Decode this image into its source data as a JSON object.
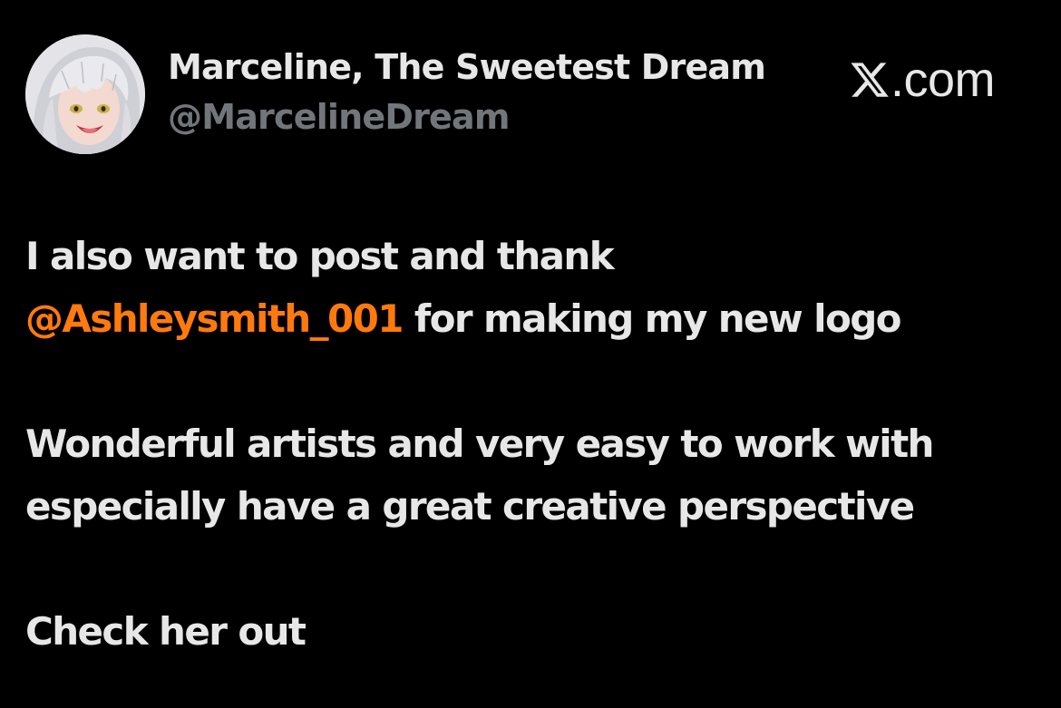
{
  "author": {
    "display_name": "Marceline, The Sweetest Dream",
    "handle": "@MarcelineDream",
    "avatar_icon": "anime-character-avatar"
  },
  "brand": {
    "icon": "x-logo-icon",
    "text": ".com"
  },
  "post": {
    "line1": "I also want to post and thank",
    "mention": "@Ashleysmith_001",
    "line2_rest": " for making my new logo",
    "line3": "Wonderful artists and very easy to work with",
    "line4": "especially have a great creative perspective",
    "line5": "Check her out"
  },
  "colors": {
    "background": "#000000",
    "text": "#e7e7e7",
    "handle": "#71767b",
    "mention": "#ff7a0e"
  }
}
